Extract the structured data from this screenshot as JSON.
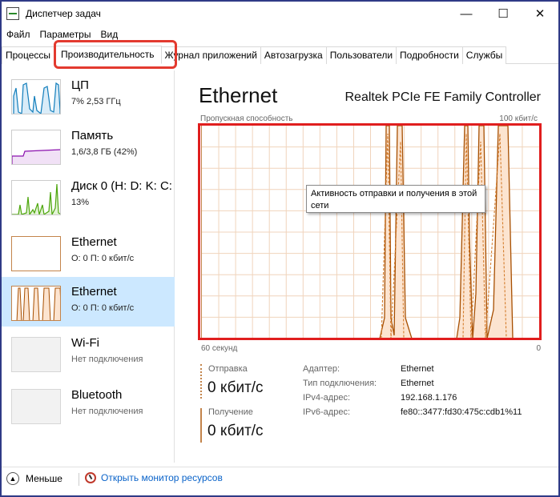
{
  "window": {
    "title": "Диспетчер задач",
    "controls": {
      "minimize": "—",
      "maximize": "☐",
      "close": "✕"
    }
  },
  "menu": [
    "Файл",
    "Параметры",
    "Вид"
  ],
  "tabs": [
    {
      "label": "Процессы",
      "active": false
    },
    {
      "label": "Производительность",
      "active": true
    },
    {
      "label": "Журнал приложений",
      "active": false
    },
    {
      "label": "Автозагрузка",
      "active": false
    },
    {
      "label": "Пользователи",
      "active": false
    },
    {
      "label": "Подробности",
      "active": false
    },
    {
      "label": "Службы",
      "active": false
    }
  ],
  "sidebar": {
    "items": [
      {
        "name": "ЦП",
        "sub": "7% 2,53 ГГц",
        "selected": false,
        "color": "#117dbb"
      },
      {
        "name": "Память",
        "sub": "1,6/3,8 ГБ (42%)",
        "selected": false,
        "color": "#8b12ae"
      },
      {
        "name": "Диск 0 (H: D: K: C:",
        "sub": "13%",
        "selected": false,
        "color": "#4da60c"
      },
      {
        "name": "Ethernet",
        "sub": "О: 0 П: 0 кбит/с",
        "selected": false,
        "color": "#a74f01"
      },
      {
        "name": "Ethernet",
        "sub": "О: 0 П: 0 кбит/с",
        "selected": true,
        "color": "#a74f01"
      },
      {
        "name": "Wi-Fi",
        "sub": "Нет подключения",
        "selected": false,
        "color": "#cccccc"
      },
      {
        "name": "Bluetooth",
        "sub": "Нет подключения",
        "selected": false,
        "color": "#cccccc"
      }
    ]
  },
  "main": {
    "title": "Ethernet",
    "adapter": "Realtek PCIe FE Family Controller",
    "graph": {
      "label_top_left": "Пропускная способность",
      "label_top_right": "100 кбит/с",
      "label_bottom_left": "60 секунд",
      "label_bottom_right": "0",
      "line_color": "#a74f01",
      "fill_color": "#fce4d0",
      "grid_color": "#f0d4bc"
    },
    "tooltip": "Активность отправки и получения в этой сети",
    "send": {
      "label": "Отправка",
      "value": "0 кбит/с"
    },
    "receive": {
      "label": "Получение",
      "value": "0 кбит/с"
    },
    "properties": [
      {
        "key": "Адаптер:",
        "value": "Ethernet"
      },
      {
        "key": "Тип подключения:",
        "value": "Ethernet"
      },
      {
        "key": "IPv4-адрес:",
        "value": "192.168.1.176"
      },
      {
        "key": "IPv6-адрес:",
        "value": "fe80::3477:fd30:475c:cdb1%11"
      }
    ]
  },
  "footer": {
    "less_label": "Меньше",
    "monitor_label": "Открыть монитор ресурсов"
  },
  "highlight_color": "#e01e1e"
}
